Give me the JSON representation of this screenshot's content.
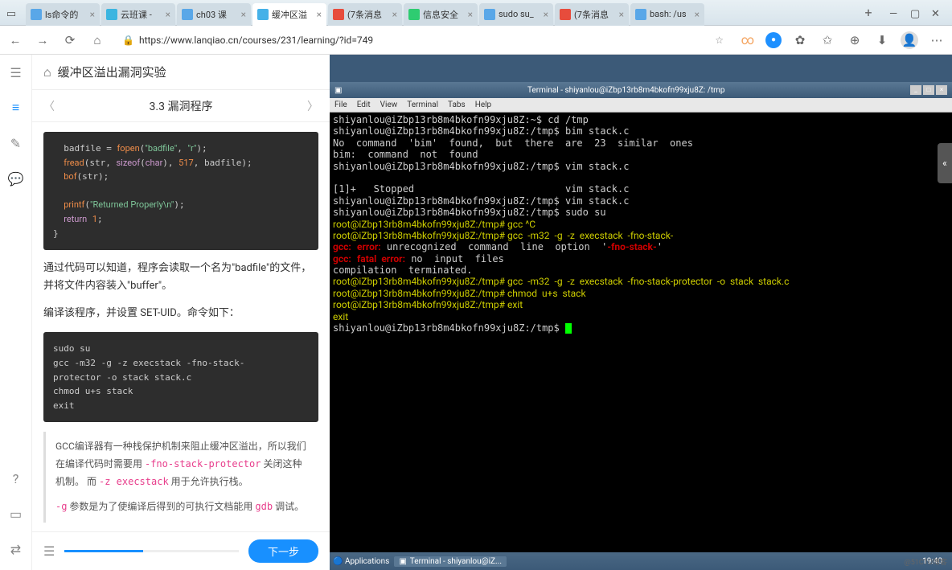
{
  "browser": {
    "tabs": [
      {
        "label": "ls命令的",
        "fav": "#59a7e8",
        "x": "×"
      },
      {
        "label": "云班课 -",
        "fav": "#3bb5e0",
        "x": "×"
      },
      {
        "label": "ch03 课",
        "fav": "#59a7e8",
        "x": "×"
      },
      {
        "label": "缓冲区溢",
        "fav": "#45b1e8",
        "x": "×",
        "active": true
      },
      {
        "label": "(7条消息",
        "fav": "#e74c3c",
        "x": "×"
      },
      {
        "label": "信息安全",
        "fav": "#2ecc71",
        "x": "×"
      },
      {
        "label": "sudo su_",
        "fav": "#59a7e8",
        "x": "×"
      },
      {
        "label": "(7条消息",
        "fav": "#e74c3c",
        "x": "×"
      },
      {
        "label": "bash: /us",
        "fav": "#59a7e8",
        "x": "×"
      }
    ],
    "url": "https://www.lanqiao.cn/courses/231/learning/?id=749"
  },
  "sidebar": {
    "icons": [
      "▭",
      "≡",
      "✎",
      "◌"
    ],
    "bottom": [
      "?",
      "▭",
      "⇄"
    ]
  },
  "lesson": {
    "title": "缓冲区溢出漏洞实验",
    "section": "3.3 漏洞程序",
    "code1": "  badfile = fopen(\"badfile\", \"r\");\n  fread(str, sizeof(char), 517, badfile);\n  bof(str);\n\n  printf(\"Returned Properly\\n\");\n  return 1;\n}",
    "para1": "通过代码可以知道，程序会读取一个名为\"badfile\"的文件，并将文件内容装入\"buffer\"。",
    "para2": "编译该程序，并设置 SET-UID。命令如下：",
    "code2": "sudo su\ngcc -m32 -g -z execstack -fno-stack-\nprotector -o stack stack.c\nchmod u+s stack\nexit",
    "note1a": "GCC编译器有一种栈保护机制来阻止缓冲区溢出，所以我们在编译代码时需要用 ",
    "note1b": "-fno-stack-protector",
    "note1c": " 关闭这种机制。 而 ",
    "note1d": "-z execstack",
    "note1e": " 用于允许执行栈。",
    "note2a": "-g",
    "note2b": " 参数是为了使编译后得到的可执行文档能用 ",
    "note2c": "gdb",
    "note2d": " 调试。",
    "next": "下一步"
  },
  "terminal": {
    "title": "Terminal - shiyanlou@iZbp13rb8m4bkofn99xju8Z: /tmp",
    "menu": [
      "File",
      "Edit",
      "View",
      "Terminal",
      "Tabs",
      "Help"
    ],
    "lines": [
      {
        "t": "shiyanlou@iZbp13rb8m4bkofn99xju8Z:~$ cd /tmp"
      },
      {
        "t": "shiyanlou@iZbp13rb8m4bkofn99xju8Z:/tmp$ bim stack.c"
      },
      {
        "t": "No  command  'bim'  found,  but  there  are  23  similar  ones"
      },
      {
        "t": "bim:  command  not  found"
      },
      {
        "t": "shiyanlou@iZbp13rb8m4bkofn99xju8Z:/tmp$ vim stack.c"
      },
      {
        "t": ""
      },
      {
        "t": "[1]+   Stopped                          vim stack.c"
      },
      {
        "t": "shiyanlou@iZbp13rb8m4bkofn99xju8Z:/tmp$ vim stack.c"
      },
      {
        "t": "shiyanlou@iZbp13rb8m4bkofn99xju8Z:/tmp$ sudo su"
      },
      {
        "t": "root@iZbp13rb8m4bkofn99xju8Z:/tmp# gcc ^C",
        "y": true
      },
      {
        "t": "root@iZbp13rb8m4bkofn99xju8Z:/tmp# gcc  -m32  -g  -z  execstack  -fno-stack-",
        "y": true
      },
      {
        "html": "<span class='red'>gcc:</span> <span class='red'>error:</span> unrecognized  command  line  option  '<span class='red'>-fno-stack-</span>'"
      },
      {
        "html": "<span class='red'>gcc:</span> <span class='red'>fatal  error:</span> no  input  files"
      },
      {
        "t": "compilation  terminated."
      },
      {
        "t": "root@iZbp13rb8m4bkofn99xju8Z:/tmp# gcc  -m32  -g  -z  execstack  -fno-stack-protector  -o  stack  stack.c",
        "y": true
      },
      {
        "t": "root@iZbp13rb8m4bkofn99xju8Z:/tmp# chmod  u+s  stack",
        "y": true
      },
      {
        "t": "root@iZbp13rb8m4bkofn99xju8Z:/tmp# exit",
        "y": true
      },
      {
        "t": "exit",
        "y": true
      },
      {
        "prompt": "shiyanlou@iZbp13rb8m4bkofn99xju8Z:/tmp$ ",
        "cursor": true
      }
    ],
    "taskbar": {
      "apps": "Applications",
      "term": "Terminal - shiyanlou@iZ...",
      "time": "19:40"
    }
  },
  "watermark": "@51CTO博客"
}
